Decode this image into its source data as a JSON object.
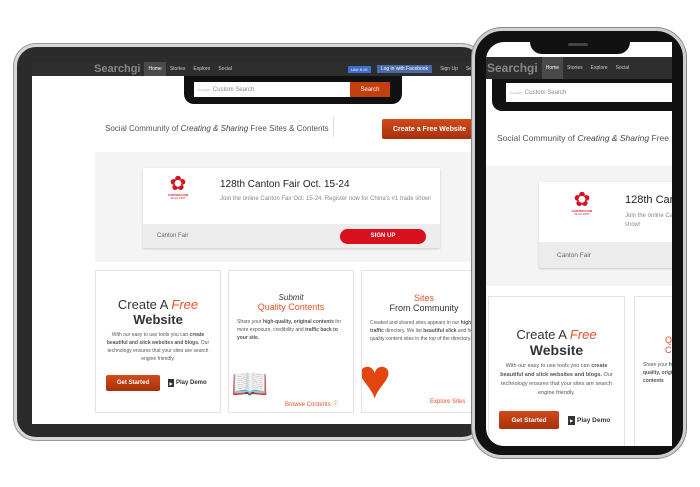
{
  "site": {
    "logo": "Searchgi",
    "nav": [
      "Home",
      "Stories",
      "Explore",
      "Social"
    ],
    "like": "Like 8.1K",
    "fb_login": "Log in with Facebook",
    "signup": "Sign Up",
    "more": "Se"
  },
  "search": {
    "google": "Google",
    "placeholder": "Custom Search",
    "button": "Search"
  },
  "hero": {
    "prefix": "Social Community of ",
    "emph": "Creating & Sharing",
    "suffix": " Free Sites & Contents",
    "cta": "Create a Free Website"
  },
  "ad": {
    "logo_text": "CANTON FAIR",
    "logo_since": "Since 1957",
    "title": "128th Canton Fair Oct. 15-24",
    "text": "Join the online Canton Fair Oct. 15-24. Register now for China's #1 trade show!",
    "advertiser": "Canton Fair",
    "button": "SIGN UP"
  },
  "cards": {
    "create": {
      "t1": "Create A ",
      "t1em": "Free",
      "t2": "Website",
      "p1": "With our easy to use tools you can ",
      "p1b": "create beautiful and slick websites and blogs.",
      "p2": " Our technology ensures that your sites are search engine friendly.",
      "btn": "Get Started",
      "demo": "Play Demo"
    },
    "submit": {
      "t1": "Submit",
      "t2": "Quality Contents",
      "p1": "Share your ",
      "p1b": "high-quality, original contents",
      "p2": " for more exposure, credibility and ",
      "p2b": "traffic back to your site.",
      "link": "Browse Contents"
    },
    "sites": {
      "t1": "Sites",
      "t2": "From Community",
      "p1": "Created and shared sites appears in our ",
      "p1b": "high traffic",
      "p2": " directory. We list ",
      "p2b": "beautiful slick",
      "p3": " and high quality content sites in the top of the directory.",
      "link": "Explore Sites"
    }
  },
  "colors": {
    "accent": "#c2400f",
    "ad_red": "#d9101e"
  }
}
